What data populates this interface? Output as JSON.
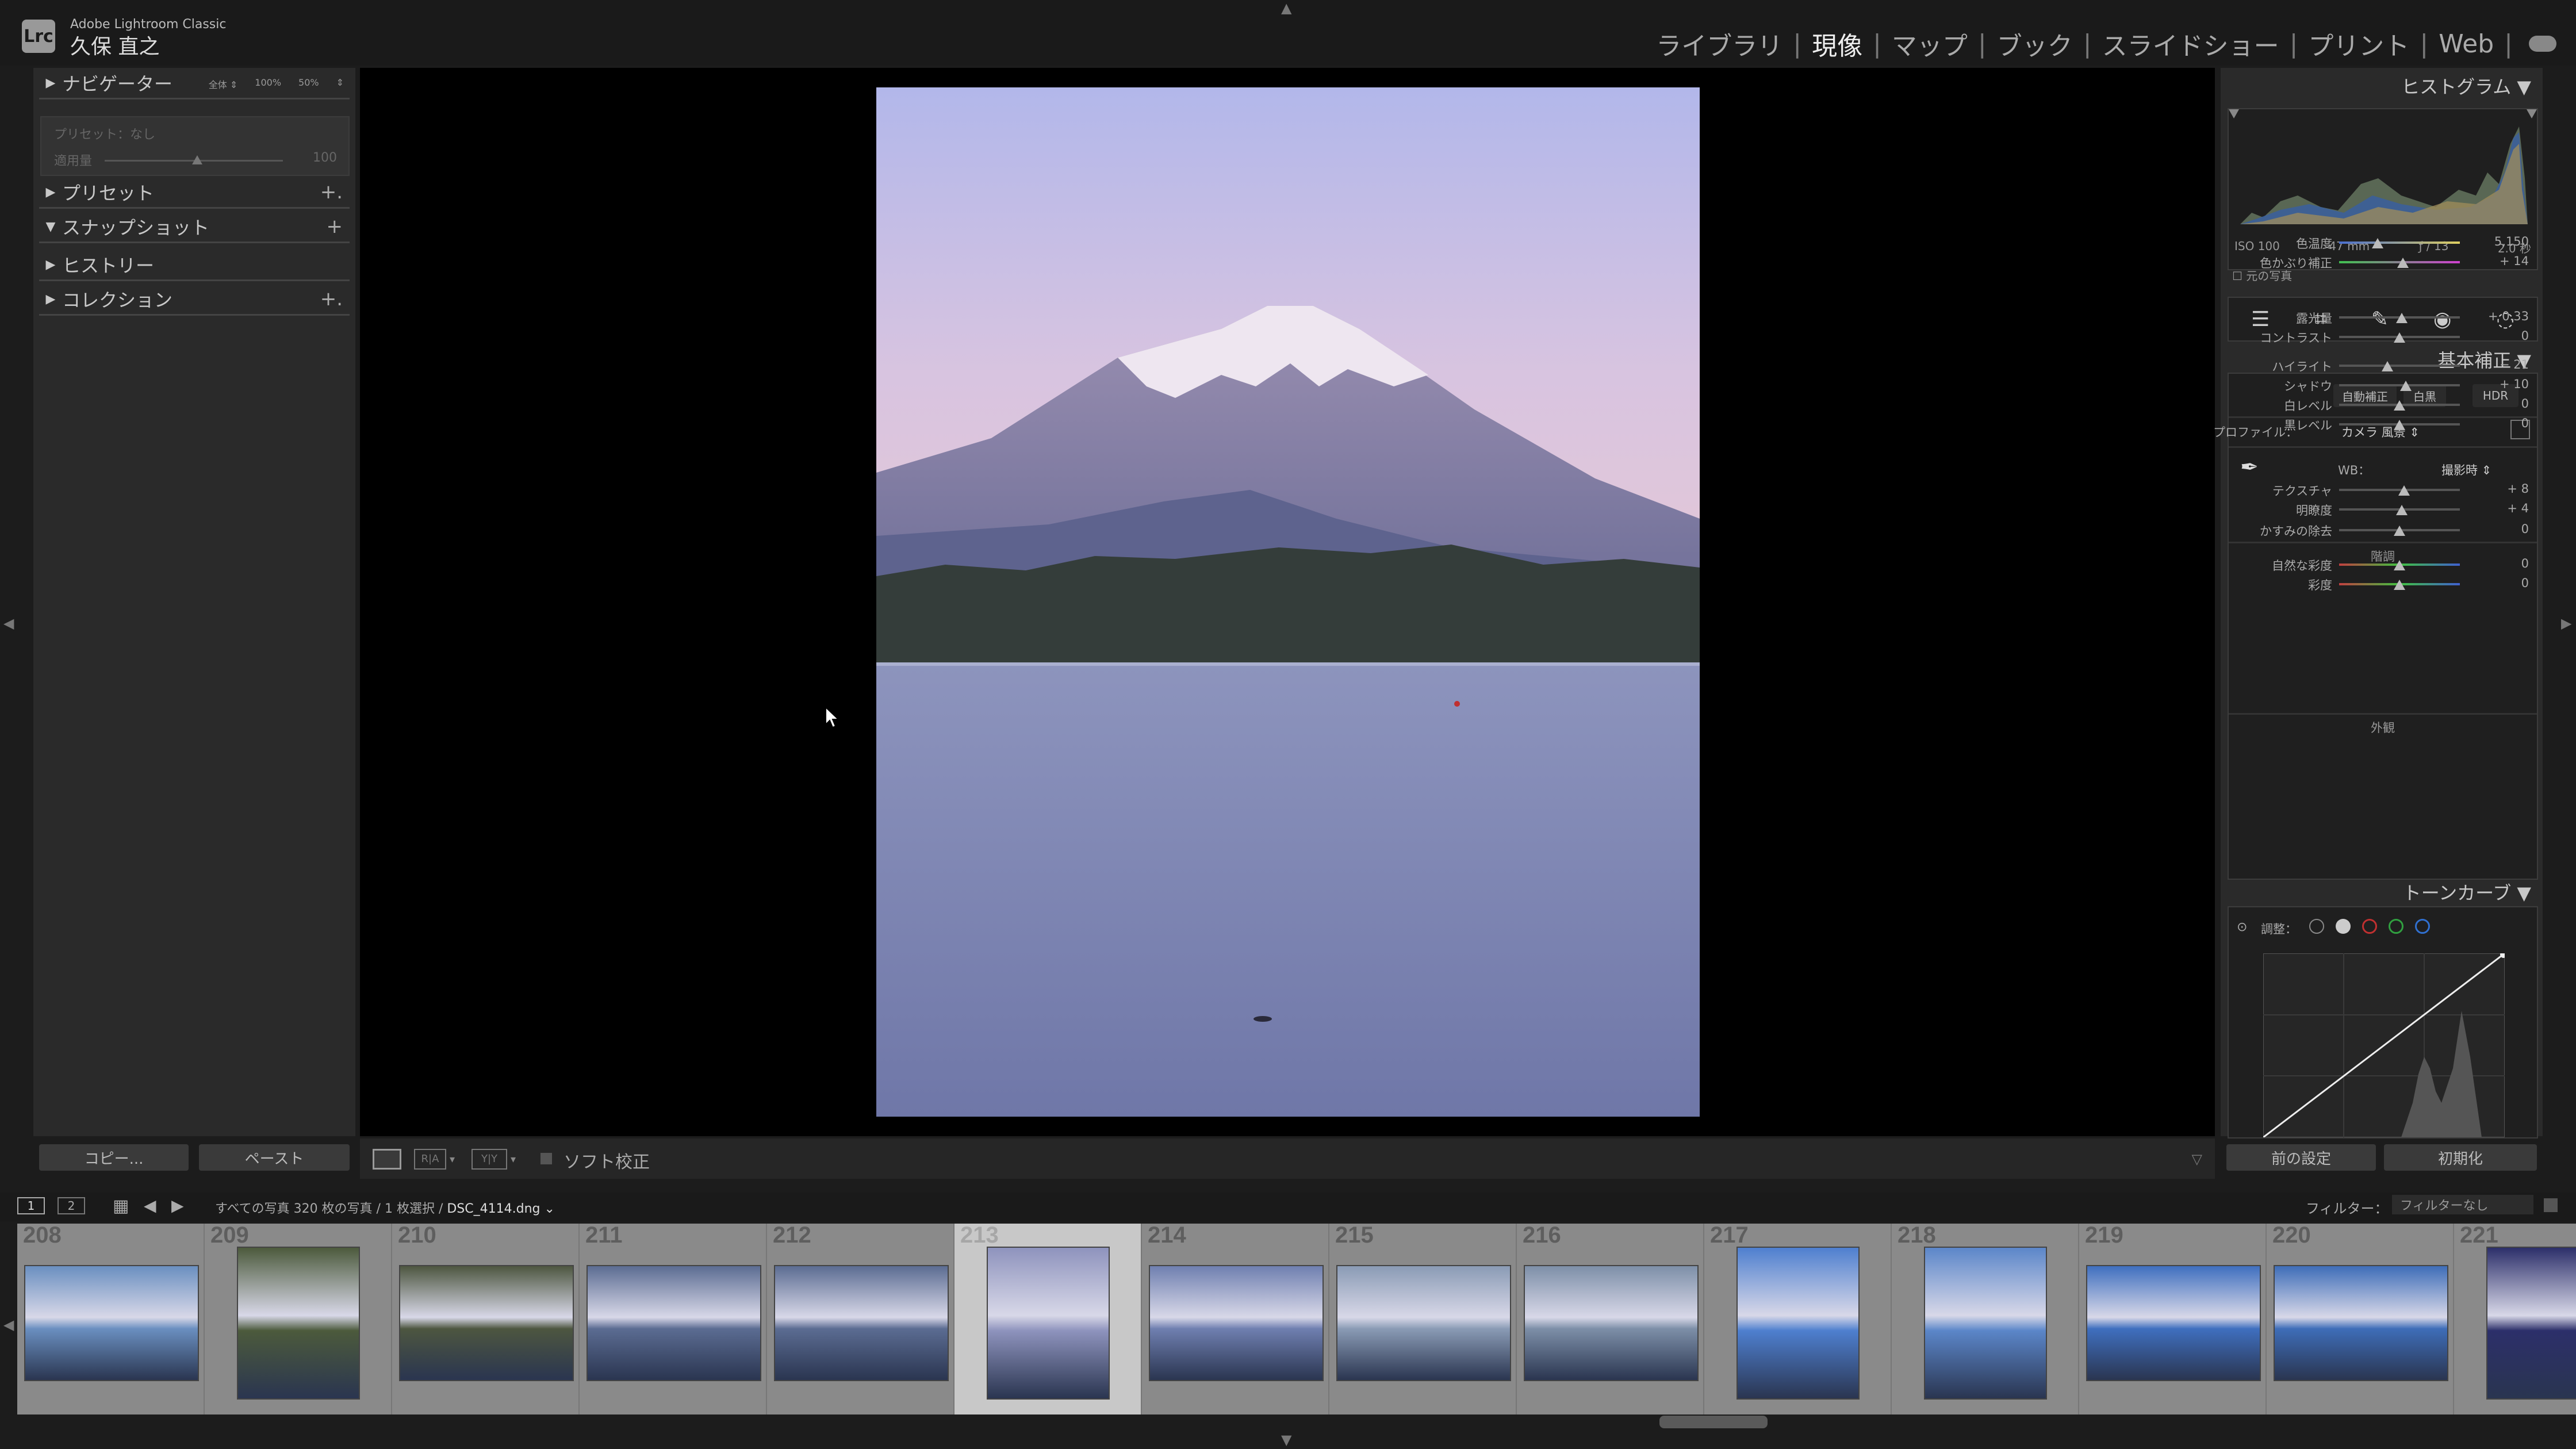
{
  "app": {
    "logo": "Lrc",
    "name": "Adobe Lightroom Classic",
    "user": "久保 直之"
  },
  "modules": [
    {
      "label": "ライブラリ",
      "active": false
    },
    {
      "label": "現像",
      "active": true
    },
    {
      "label": "マップ",
      "active": false
    },
    {
      "label": "ブック",
      "active": false
    },
    {
      "label": "スライドショー",
      "active": false
    },
    {
      "label": "プリント",
      "active": false
    },
    {
      "label": "Web",
      "active": false
    }
  ],
  "left_panel": {
    "navigator": {
      "label": "ナビゲーター",
      "zoom": [
        "全体 ⇕",
        "100%",
        "50%",
        "⇕"
      ]
    },
    "preset_name": "プリセット：なし",
    "amount_label": "適用量",
    "amount_value": "100",
    "amount_fraction": 0.72,
    "sections": [
      {
        "label": "プリセット",
        "expanded": false,
        "plus": "+."
      },
      {
        "label": "スナップショット",
        "expanded": true,
        "plus": "+"
      },
      {
        "label": "ヒストリー",
        "expanded": false,
        "plus": ""
      },
      {
        "label": "コレクション",
        "expanded": false,
        "plus": "+."
      }
    ],
    "copy_button": "コピー...",
    "paste_button": "ペースト"
  },
  "toolbar": {
    "soft_proof": "ソフト校正"
  },
  "right_panel": {
    "histogram_title": "ヒストグラム ▼",
    "histogram_info": [
      "ISO 100",
      "47 mm",
      "ƒ / 13",
      "2.0 秒"
    ],
    "original_photo": "元の写真",
    "basic_title": "基本補正 ▼",
    "auto": "自動補正",
    "bw": "白黒",
    "hdr": "HDR",
    "profile_label": "プロファイル：",
    "profile_value": "カメラ 風景 ⇕",
    "wb_label": "WB：",
    "wb_value": "撮影時 ⇕",
    "tone_group": "階調",
    "presence_group": "外観",
    "sliders": [
      {
        "name": "temp",
        "label": "色温度",
        "value": "5,150",
        "pos": 0.32
      },
      {
        "name": "tint",
        "label": "色かぶり補正",
        "value": "+ 14",
        "pos": 0.53
      },
      {
        "name": "exposure",
        "label": "露光量",
        "value": "+ 0.33",
        "pos": 0.52
      },
      {
        "name": "contrast",
        "label": "コントラスト",
        "value": "0",
        "pos": 0.5
      },
      {
        "name": "highlights",
        "label": "ハイライト",
        "value": "− 21",
        "pos": 0.4
      },
      {
        "name": "shadows",
        "label": "シャドウ",
        "value": "+ 10",
        "pos": 0.55
      },
      {
        "name": "whites",
        "label": "白レベル",
        "value": "0",
        "pos": 0.5
      },
      {
        "name": "blacks",
        "label": "黒レベル",
        "value": "0",
        "pos": 0.5
      },
      {
        "name": "texture",
        "label": "テクスチャ",
        "value": "+ 8",
        "pos": 0.54
      },
      {
        "name": "clarity",
        "label": "明瞭度",
        "value": "+ 4",
        "pos": 0.52
      },
      {
        "name": "dehaze",
        "label": "かすみの除去",
        "value": "0",
        "pos": 0.5
      },
      {
        "name": "vibrance",
        "label": "自然な彩度",
        "value": "0",
        "pos": 0.5
      },
      {
        "name": "saturation",
        "label": "彩度",
        "value": "0",
        "pos": 0.5
      }
    ],
    "tone_curve_title": "トーンカーブ ▼",
    "adjust_label": "調整：",
    "prev_button": "前の設定",
    "reset_button": "初期化"
  },
  "filmstrip_bar": {
    "page1": "1",
    "page2": "2",
    "source": "すべての写真   320 枚の写真 / 1 枚選択 /",
    "filename": "DSC_4114.dng ⌄",
    "filter_label": "フィルター：",
    "filter_value": "フィルターなし"
  },
  "filmstrip": [
    {
      "num": "208",
      "selected": false,
      "tone": "#6a8fc0"
    },
    {
      "num": "209",
      "selected": false,
      "tone": "#4c5a3c"
    },
    {
      "num": "210",
      "selected": false,
      "tone": "#4d5640"
    },
    {
      "num": "211",
      "selected": false,
      "tone": "#5b6c92"
    },
    {
      "num": "212",
      "selected": false,
      "tone": "#5b6c92"
    },
    {
      "num": "213",
      "selected": true,
      "tone": "#8e93bd"
    },
    {
      "num": "214",
      "selected": false,
      "tone": "#6f7fb0"
    },
    {
      "num": "215",
      "selected": false,
      "tone": "#8a9bb5"
    },
    {
      "num": "216",
      "selected": false,
      "tone": "#7d8fa8"
    },
    {
      "num": "217",
      "selected": false,
      "tone": "#4e7fcf"
    },
    {
      "num": "218",
      "selected": false,
      "tone": "#5b86c9"
    },
    {
      "num": "219",
      "selected": false,
      "tone": "#3f6fbf"
    },
    {
      "num": "220",
      "selected": false,
      "tone": "#3e6db8"
    },
    {
      "num": "221",
      "selected": false,
      "tone": "#2c2f6a"
    }
  ]
}
